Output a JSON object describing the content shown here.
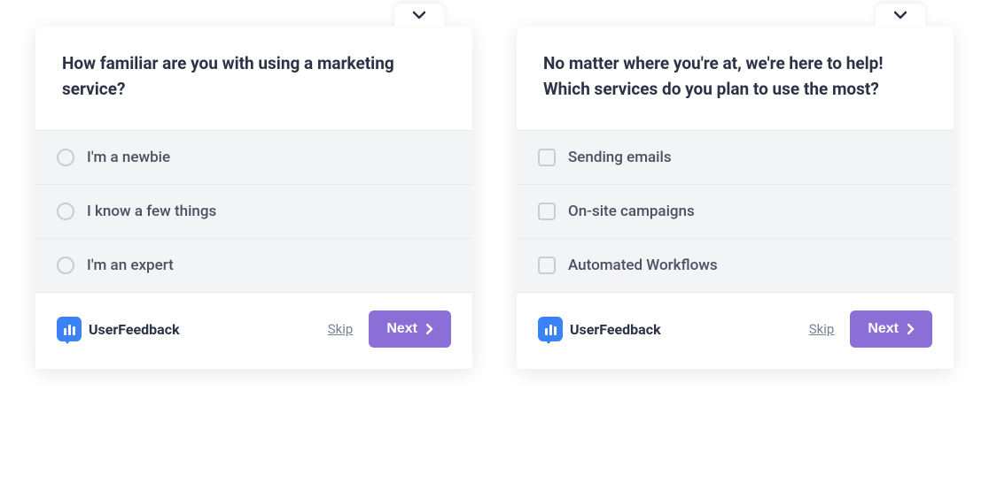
{
  "brand": {
    "name": "UserFeedback"
  },
  "actions": {
    "skip": "Skip",
    "next": "Next"
  },
  "surveys": [
    {
      "question": "How familiar are you with using a marketing service?",
      "input_type": "radio",
      "options": [
        "I'm a newbie",
        "I know a few things",
        "I'm an expert"
      ]
    },
    {
      "question": "No matter where you're at, we're here to help! Which services do you plan to use the most?",
      "input_type": "checkbox",
      "options": [
        "Sending emails",
        "On-site campaigns",
        "Automated Workflows"
      ]
    }
  ]
}
